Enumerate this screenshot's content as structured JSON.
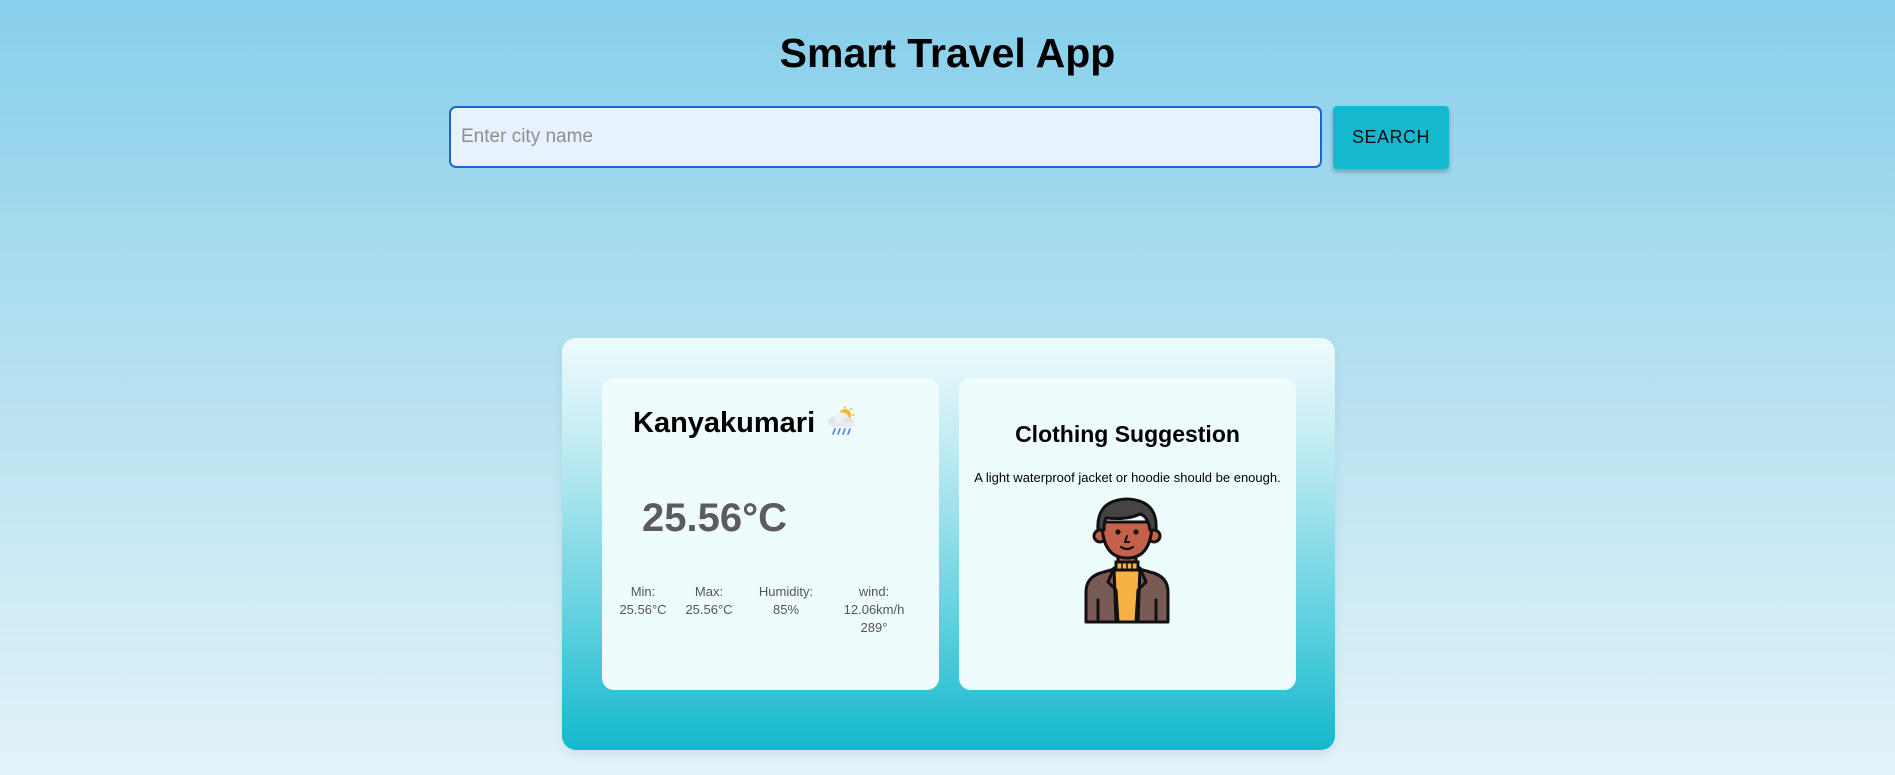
{
  "app": {
    "title": "Smart Travel App"
  },
  "search": {
    "placeholder": "Enter city name",
    "value": "",
    "button_label": "SEARCH"
  },
  "weather": {
    "city": "Kanyakumari",
    "icon": "rain-cloud-sun-icon",
    "temperature": "25.56°C",
    "min_label": "Min:",
    "min_value": "25.56°C",
    "max_label": "Max:",
    "max_value": "25.56°C",
    "humidity_label": "Humidity:",
    "humidity_value": "85%",
    "wind_label": "wind:",
    "wind_speed": "12.06km/h",
    "wind_direction": "289°"
  },
  "clothing": {
    "title": "Clothing Suggestion",
    "suggestion": "A light waterproof jacket or hoodie should be enough.",
    "illustration": "person-in-jacket-icon"
  },
  "colors": {
    "accent": "#14b9cf",
    "input_border": "#1a67c9",
    "input_background": "#e8f1fe",
    "card_background": "#effcfd"
  }
}
